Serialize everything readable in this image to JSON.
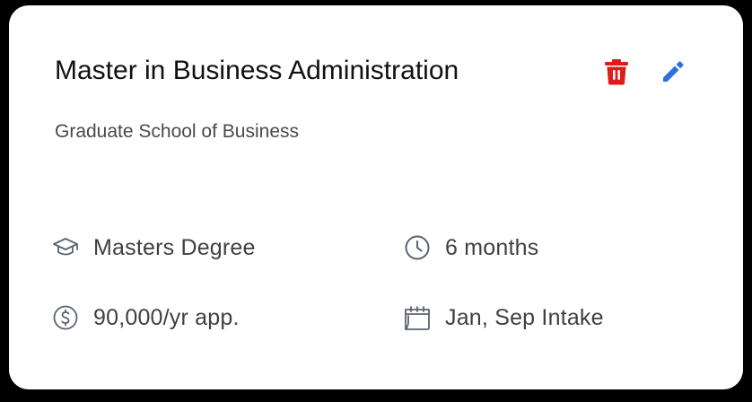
{
  "card": {
    "title": "Master in Business Administration",
    "subtitle": "Graduate School of Business",
    "actions": {
      "delete_icon": "trash-icon",
      "edit_icon": "pencil-icon"
    },
    "meta": {
      "degree": {
        "icon": "graduation-cap-icon",
        "text": "Masters Degree"
      },
      "duration": {
        "icon": "clock-icon",
        "text": "6 months"
      },
      "fee": {
        "icon": "dollar-circle-icon",
        "text": "90,000/yr app."
      },
      "intake": {
        "icon": "calendar-icon",
        "text": "Jan, Sep Intake"
      }
    }
  },
  "colors": {
    "delete": "#e01b1b",
    "edit": "#2f6fe0",
    "icon": "#5b6270",
    "title": "#111111",
    "subtitle": "#4a4a4a",
    "meta_text": "#3f3f46"
  }
}
